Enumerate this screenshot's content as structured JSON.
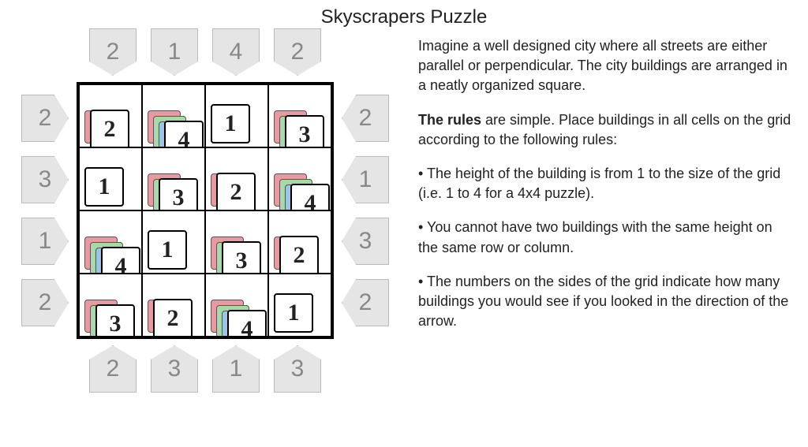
{
  "title": "Skyscrapers Puzzle",
  "intro": "Imagine a well designed city where all streets are either parallel or perpendicular. The city buildings are arranged in a neatly organized square.",
  "rules_lead_strong": "The rules",
  "rules_lead_rest": " are simple. Place buildings in all cells on the grid according to the following rules:",
  "rules": [
    "• The height of the building is from 1 to the size of the grid (i.e. 1 to 4 for a 4x4 puzzle).",
    "• You cannot have two buildings with the same height on the same row or column.",
    "• The numbers on the sides of the grid indicate how many buildings you would see if you looked in the direction of the arrow."
  ],
  "clues": {
    "top": [
      2,
      1,
      4,
      2
    ],
    "bottom": [
      2,
      3,
      1,
      3
    ],
    "left": [
      2,
      3,
      1,
      2
    ],
    "right": [
      2,
      1,
      3,
      2
    ]
  },
  "grid": [
    [
      2,
      4,
      1,
      3
    ],
    [
      1,
      3,
      2,
      4
    ],
    [
      4,
      1,
      3,
      2
    ],
    [
      3,
      2,
      4,
      1
    ]
  ],
  "layer_colors": [
    "red",
    "green",
    "blue",
    "purple"
  ]
}
